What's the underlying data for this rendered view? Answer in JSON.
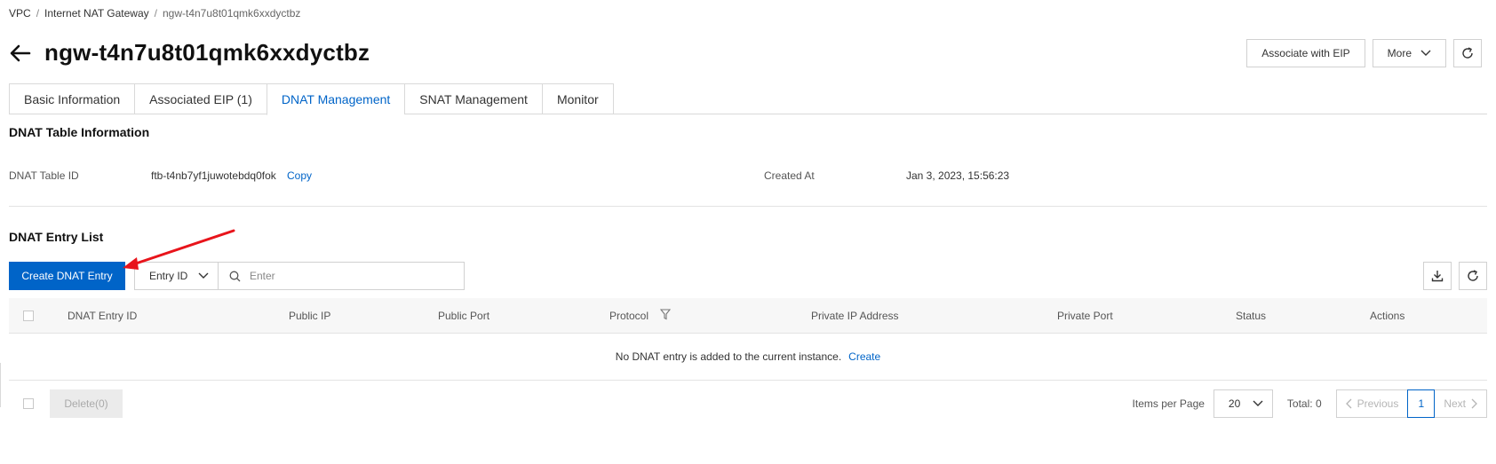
{
  "breadcrumb": {
    "items": [
      "VPC",
      "Internet NAT Gateway",
      "ngw-t4n7u8t01qmk6xxdyctbz"
    ],
    "separator": "/"
  },
  "header": {
    "title": "ngw-t4n7u8t01qmk6xxdyctbz",
    "associate_eip_label": "Associate with EIP",
    "more_label": "More"
  },
  "tabs": [
    {
      "label": "Basic Information"
    },
    {
      "label": "Associated EIP (1)"
    },
    {
      "label": "DNAT Management"
    },
    {
      "label": "SNAT Management"
    },
    {
      "label": "Monitor"
    }
  ],
  "dnat_table_info": {
    "section_title": "DNAT Table Information",
    "id_label": "DNAT Table ID",
    "id_value": "ftb-t4nb7yf1juwotebdq0fok",
    "copy_label": "Copy",
    "created_label": "Created At",
    "created_value": "Jan 3, 2023, 15:56:23"
  },
  "entry_list": {
    "section_title": "DNAT Entry List",
    "create_button": "Create DNAT Entry",
    "search_field_select": "Entry ID",
    "search_placeholder": "Enter",
    "columns": [
      "DNAT Entry ID",
      "Public IP",
      "Public Port",
      "Protocol",
      "Private IP Address",
      "Private Port",
      "Status",
      "Actions"
    ],
    "empty_text": "No DNAT entry is added to the current instance.",
    "empty_create_link": "Create"
  },
  "footer": {
    "delete_label": "Delete(0)",
    "items_per_page_label": "Items per Page",
    "items_per_page_value": "20",
    "total_label": "Total: 0",
    "previous_label": "Previous",
    "current_page": "1",
    "next_label": "Next"
  },
  "colors": {
    "primary": "#0064c8",
    "annotation_arrow": "#e8141b"
  }
}
